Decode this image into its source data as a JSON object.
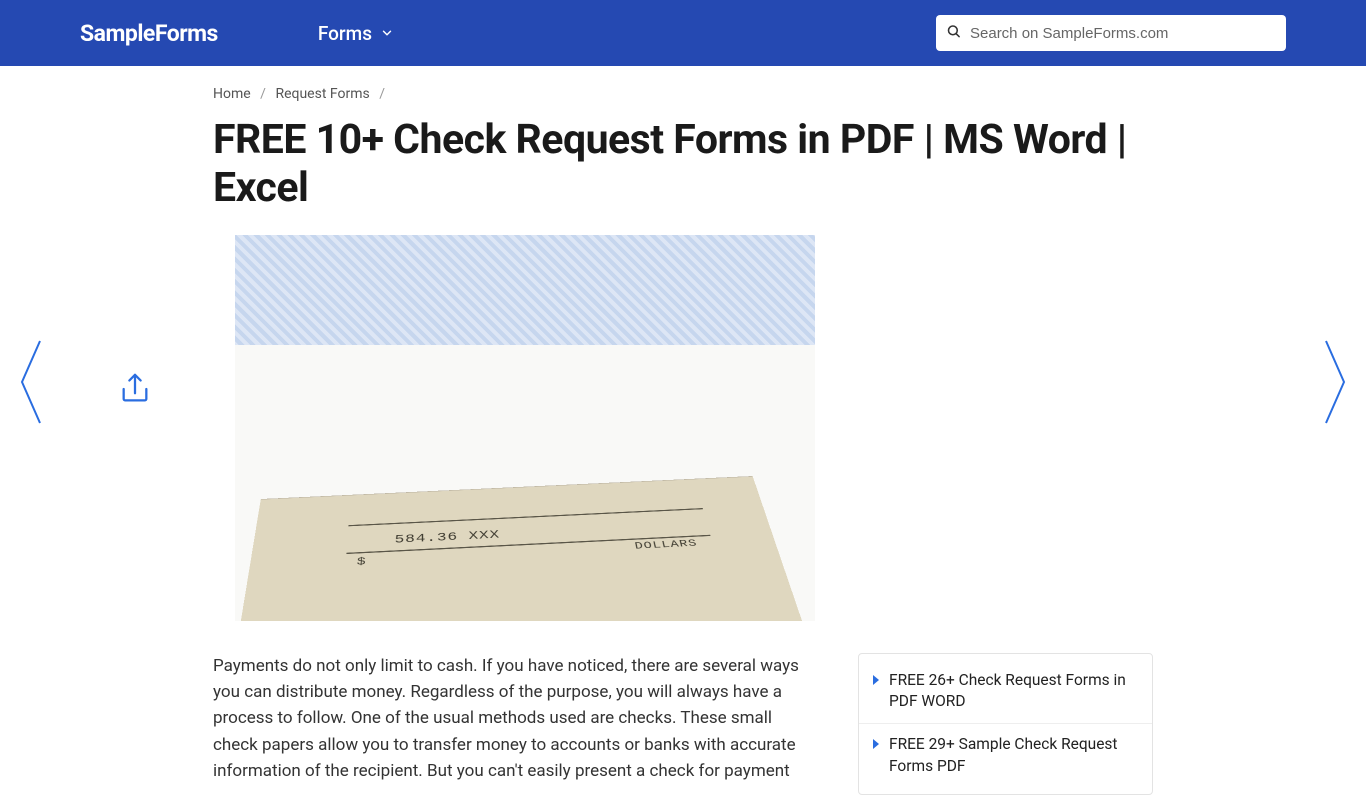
{
  "header": {
    "logo": "SampleForms",
    "nav_forms": "Forms",
    "search_placeholder": "Search on SampleForms.com"
  },
  "breadcrumb": {
    "home": "Home",
    "category": "Request Forms"
  },
  "page": {
    "title": "FREE 10+ Check Request Forms in PDF | MS Word | Excel",
    "hero_amount": "584.36 XXX",
    "hero_dollar": "$",
    "hero_dollars_label": "DOLLARS",
    "intro": "Payments do not only limit to cash. If you have noticed, there are several ways you can distribute money. Regardless of the purpose, you will always have a process to follow. One of the usual methods used are checks. These small check papers allow you to transfer money to accounts or banks with accurate information of the recipient. But you can't easily present a check for payment"
  },
  "sidebar": {
    "items": [
      "FREE 26+ Check Request Forms in PDF WORD",
      "FREE 29+ Sample Check Request Forms PDF"
    ]
  }
}
